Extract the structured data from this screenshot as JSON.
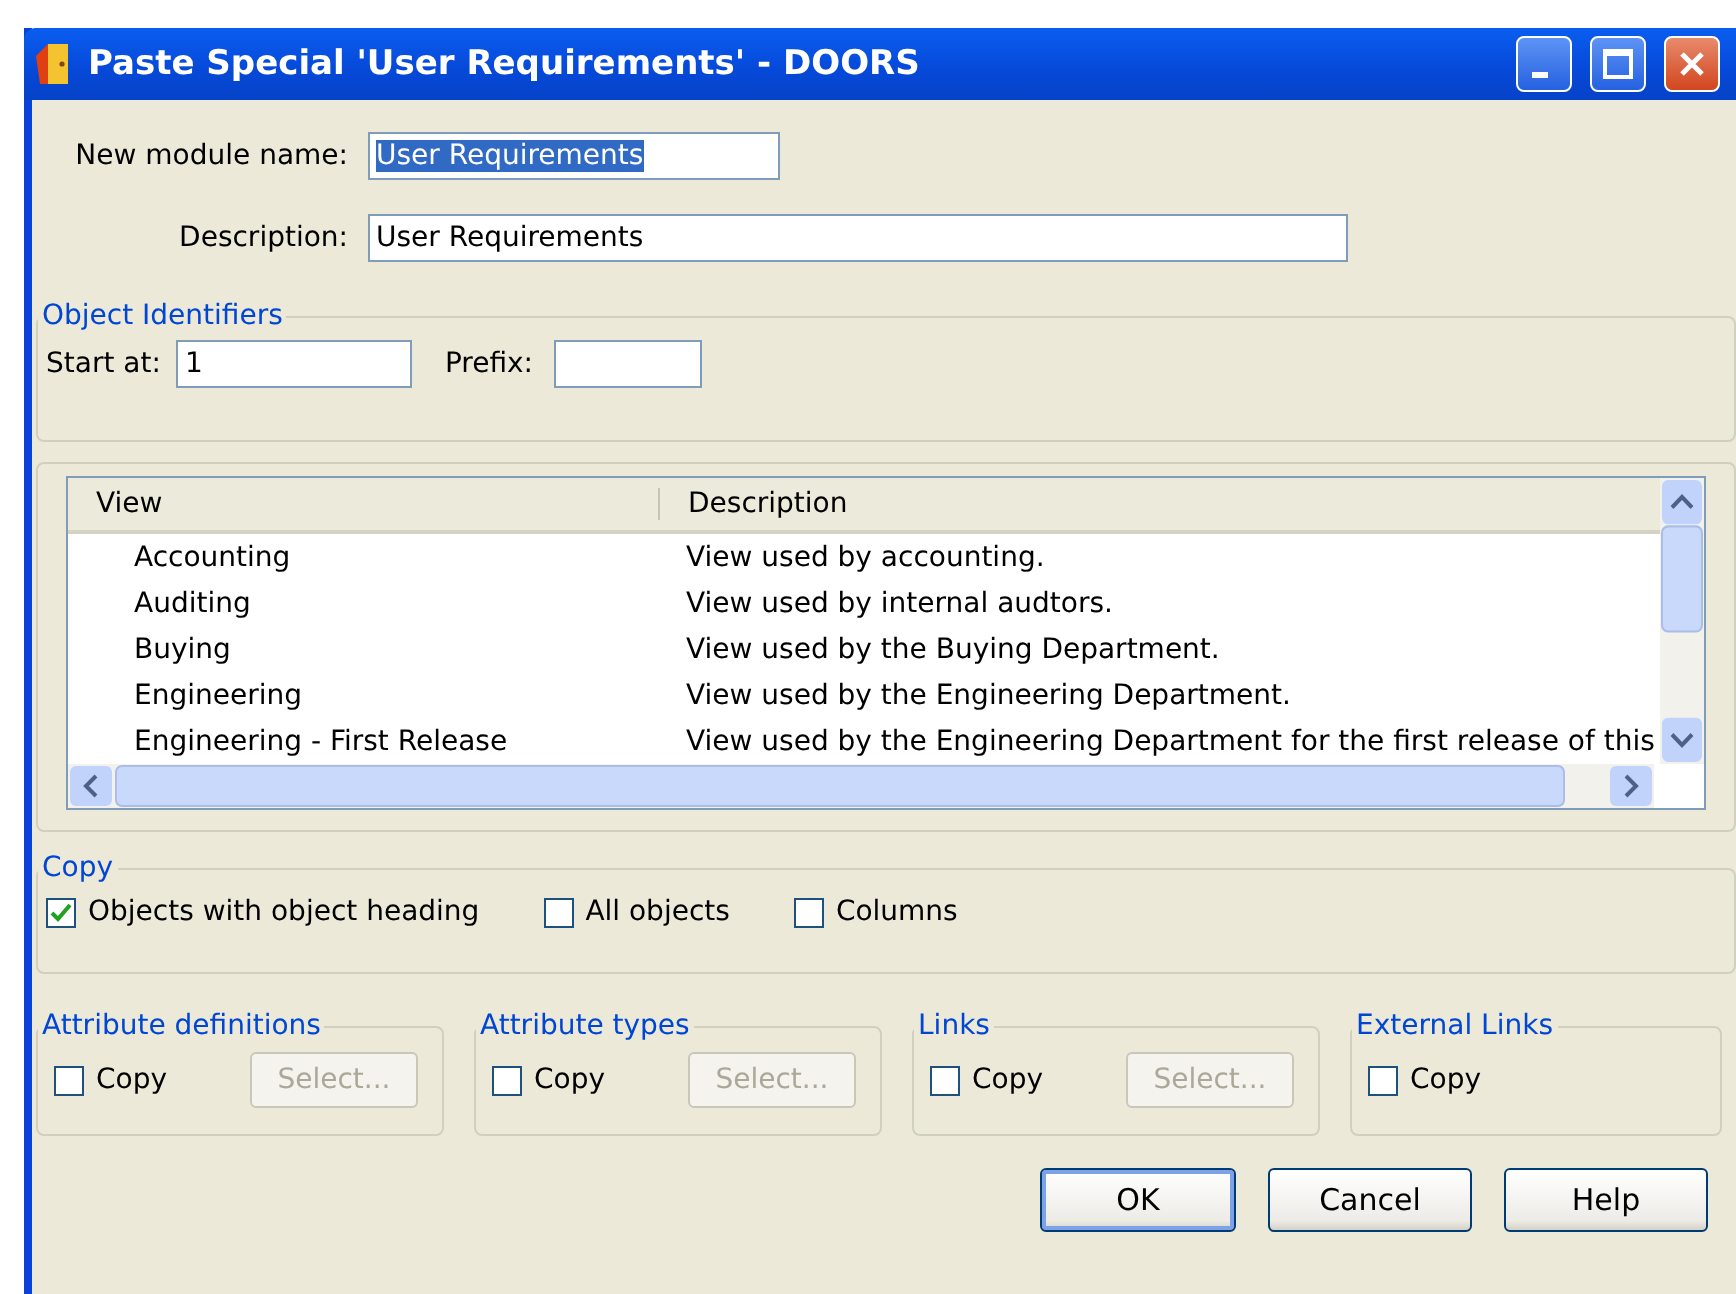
{
  "window": {
    "title": "Paste Special 'User Requirements' - DOORS"
  },
  "module_name": {
    "label": "New module name:",
    "value": "User Requirements",
    "text_selected": true
  },
  "description": {
    "label": "Description:",
    "value": "User Requirements"
  },
  "object_identifiers": {
    "title": "Object Identifiers",
    "start_at": {
      "label": "Start at:",
      "value": "1"
    },
    "prefix": {
      "label": "Prefix:"
    }
  },
  "views": {
    "columns": [
      "View",
      "Description"
    ],
    "rows": [
      {
        "view": "Accounting",
        "description": "View used by accounting."
      },
      {
        "view": "Auditing",
        "description": "View used by internal audtors."
      },
      {
        "view": "Buying",
        "description": "View used by the Buying Department."
      },
      {
        "view": "Engineering",
        "description": "View used by the Engineering Department."
      },
      {
        "view": "Engineering - First Release",
        "description": "View used by the Engineering Department for the first release of this"
      }
    ]
  },
  "copy": {
    "title": "Copy",
    "options": [
      {
        "label": "Objects with object heading",
        "checked": true
      },
      {
        "label": "All objects",
        "checked": false
      },
      {
        "label": "Columns",
        "checked": false
      }
    ]
  },
  "copy_groups": [
    {
      "title": "Attribute definitions",
      "checkbox": {
        "label": "Copy",
        "checked": false
      },
      "button": {
        "label": "Select...",
        "disabled": true
      }
    },
    {
      "title": "Attribute types",
      "checkbox": {
        "label": "Copy",
        "checked": false
      },
      "button": {
        "label": "Select...",
        "disabled": true
      }
    },
    {
      "title": "Links",
      "checkbox": {
        "label": "Copy",
        "checked": false
      },
      "button": {
        "label": "Select...",
        "disabled": true
      }
    },
    {
      "title": "External Links",
      "checkbox": {
        "label": "Copy",
        "checked": false
      }
    }
  ],
  "buttons": [
    {
      "label": "OK",
      "default": true
    },
    {
      "label": "Cancel",
      "default": false
    },
    {
      "label": "Help",
      "default": false
    }
  ]
}
